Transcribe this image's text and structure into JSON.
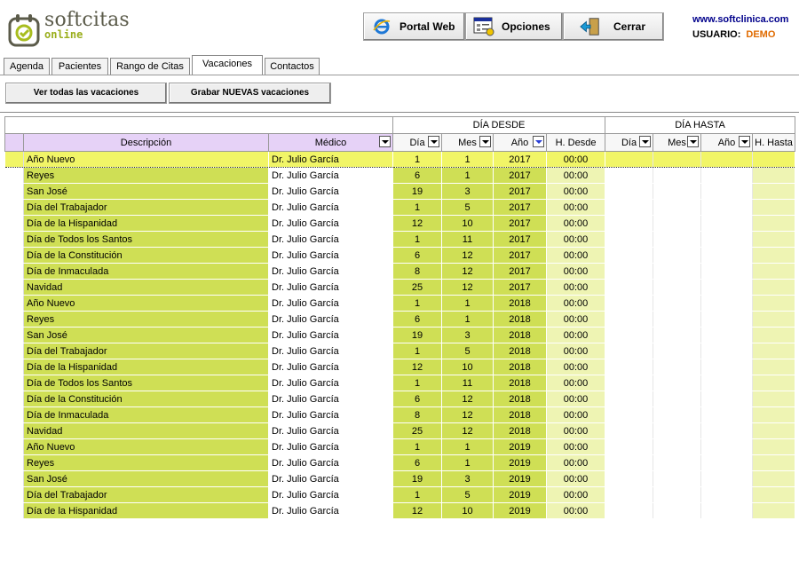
{
  "header": {
    "logo_name": "softcitas",
    "logo_sub": "online",
    "portal_label": "Portal Web",
    "options_label": "Opciones",
    "close_label": "Cerrar",
    "site": "www.softclinica.com",
    "user_label": "USUARIO:",
    "user_value": "DEMO"
  },
  "tabs": [
    {
      "label": "Agenda"
    },
    {
      "label": "Pacientes"
    },
    {
      "label": "Rango de Citas"
    },
    {
      "label": "Vacaciones"
    },
    {
      "label": "Contactos"
    }
  ],
  "actions": {
    "view_all": "Ver todas las vacaciones",
    "save_new": "Grabar NUEVAS vacaciones"
  },
  "grid": {
    "group_from": "DÍA DESDE",
    "group_to": "DÍA HASTA",
    "columns": {
      "descripcion": "Descripción",
      "medico": "Médico",
      "dia": "Día",
      "mes": "Mes",
      "anio": "Año",
      "hdesde": "H. Desde",
      "hhasta": "H. Hasta"
    },
    "rows": [
      {
        "desc": "Año Nuevo",
        "med": "Dr. Julio García",
        "dia": "1",
        "mes": "1",
        "anio": "2017",
        "hora": "00:00"
      },
      {
        "desc": "Reyes",
        "med": "Dr. Julio García",
        "dia": "6",
        "mes": "1",
        "anio": "2017",
        "hora": "00:00"
      },
      {
        "desc": "San José",
        "med": "Dr. Julio García",
        "dia": "19",
        "mes": "3",
        "anio": "2017",
        "hora": "00:00"
      },
      {
        "desc": "Día del Trabajador",
        "med": "Dr. Julio García",
        "dia": "1",
        "mes": "5",
        "anio": "2017",
        "hora": "00:00"
      },
      {
        "desc": "Día de la Hispanidad",
        "med": "Dr. Julio García",
        "dia": "12",
        "mes": "10",
        "anio": "2017",
        "hora": "00:00"
      },
      {
        "desc": "Día de Todos los Santos",
        "med": "Dr. Julio García",
        "dia": "1",
        "mes": "11",
        "anio": "2017",
        "hora": "00:00"
      },
      {
        "desc": "Día de la Constitución",
        "med": "Dr. Julio García",
        "dia": "6",
        "mes": "12",
        "anio": "2017",
        "hora": "00:00"
      },
      {
        "desc": "Día de Inmaculada",
        "med": "Dr. Julio García",
        "dia": "8",
        "mes": "12",
        "anio": "2017",
        "hora": "00:00"
      },
      {
        "desc": "Navidad",
        "med": "Dr. Julio García",
        "dia": "25",
        "mes": "12",
        "anio": "2017",
        "hora": "00:00"
      },
      {
        "desc": "Año Nuevo",
        "med": "Dr. Julio García",
        "dia": "1",
        "mes": "1",
        "anio": "2018",
        "hora": "00:00"
      },
      {
        "desc": "Reyes",
        "med": "Dr. Julio García",
        "dia": "6",
        "mes": "1",
        "anio": "2018",
        "hora": "00:00"
      },
      {
        "desc": "San José",
        "med": "Dr. Julio García",
        "dia": "19",
        "mes": "3",
        "anio": "2018",
        "hora": "00:00"
      },
      {
        "desc": "Día del Trabajador",
        "med": "Dr. Julio García",
        "dia": "1",
        "mes": "5",
        "anio": "2018",
        "hora": "00:00"
      },
      {
        "desc": "Día de la Hispanidad",
        "med": "Dr. Julio García",
        "dia": "12",
        "mes": "10",
        "anio": "2018",
        "hora": "00:00"
      },
      {
        "desc": "Día de Todos los Santos",
        "med": "Dr. Julio García",
        "dia": "1",
        "mes": "11",
        "anio": "2018",
        "hora": "00:00"
      },
      {
        "desc": "Día de la Constitución",
        "med": "Dr. Julio García",
        "dia": "6",
        "mes": "12",
        "anio": "2018",
        "hora": "00:00"
      },
      {
        "desc": "Día de Inmaculada",
        "med": "Dr. Julio García",
        "dia": "8",
        "mes": "12",
        "anio": "2018",
        "hora": "00:00"
      },
      {
        "desc": "Navidad",
        "med": "Dr. Julio García",
        "dia": "25",
        "mes": "12",
        "anio": "2018",
        "hora": "00:00"
      },
      {
        "desc": "Año Nuevo",
        "med": "Dr. Julio García",
        "dia": "1",
        "mes": "1",
        "anio": "2019",
        "hora": "00:00"
      },
      {
        "desc": "Reyes",
        "med": "Dr. Julio García",
        "dia": "6",
        "mes": "1",
        "anio": "2019",
        "hora": "00:00"
      },
      {
        "desc": "San José",
        "med": "Dr. Julio García",
        "dia": "19",
        "mes": "3",
        "anio": "2019",
        "hora": "00:00"
      },
      {
        "desc": "Día del Trabajador",
        "med": "Dr. Julio García",
        "dia": "1",
        "mes": "5",
        "anio": "2019",
        "hora": "00:00"
      },
      {
        "desc": "Día de la Hispanidad",
        "med": "Dr. Julio García",
        "dia": "12",
        "mes": "10",
        "anio": "2019",
        "hora": "00:00"
      }
    ]
  },
  "colors": {
    "row_green": "#cfdf55",
    "hour_light": "#eef4b3",
    "selected_row": "#f1f567",
    "header_lilac": "#e6d2f7",
    "user_demo": "#e06b00",
    "site_link": "#00008b"
  }
}
